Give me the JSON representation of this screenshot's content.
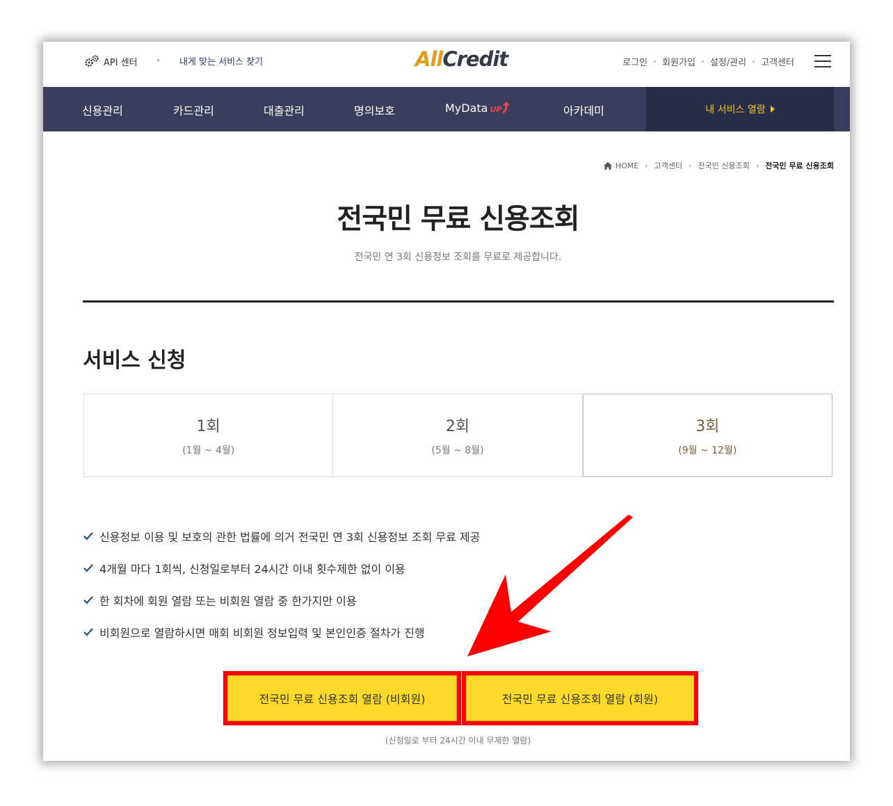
{
  "topbar": {
    "api_label": "API 센터",
    "service_find": "내게 맞는 서비스 찾기",
    "logo_all": "All",
    "logo_credit": "Credit",
    "util_links": [
      "로그인",
      "회원가입",
      "설정/관리",
      "고객센터"
    ]
  },
  "nav": {
    "items": [
      "신용관리",
      "카드관리",
      "대출관리",
      "명의보호",
      "MyData",
      "아카데미"
    ],
    "mydata_badge": "UP",
    "my_service": "내 서비스 열람"
  },
  "breadcrumb": [
    "HOME",
    "고객센터",
    "전국민 신용조회",
    "전국민 무료 신용조회"
  ],
  "page": {
    "title": "전국민 무료 신용조회",
    "subtitle": "전국민 연 3회 신용정보 조회를 무료로 제공합니다.",
    "section_title": "서비스 신청"
  },
  "rounds": [
    {
      "num": "1회",
      "range": "(1월 ~ 4월)"
    },
    {
      "num": "2회",
      "range": "(5월 ~ 8월)"
    },
    {
      "num": "3회",
      "range": "(9월 ~ 12월)"
    }
  ],
  "notes": [
    "신용정보 이용 및 보호의 관한 법률에 의거 전국민 연 3회 신용정보 조회 무료 제공",
    "4개월 마다 1회씩, 신청일로부터 24시간 이내 횟수제한 없이 이용",
    "한 회차에 회원 열람 또는 비회원 열람 중 한가지만 이용",
    "비회원으로 열람하시면 매회 비회원 정보입력 및 본인인증 절차가 진행"
  ],
  "buttons": {
    "nonmember": "전국민 무료 신용조회 열람 (비회원)",
    "member": "전국민 무료 신용조회 열람 (회원)",
    "note": "(신청일로 부터 24시간 이내 무제한 열람)"
  },
  "colors": {
    "nav_bg": "#3a3e5c",
    "accent_yellow": "#fdd928",
    "highlight_red": "#ff0000",
    "logo_orange": "#e49b1e"
  }
}
